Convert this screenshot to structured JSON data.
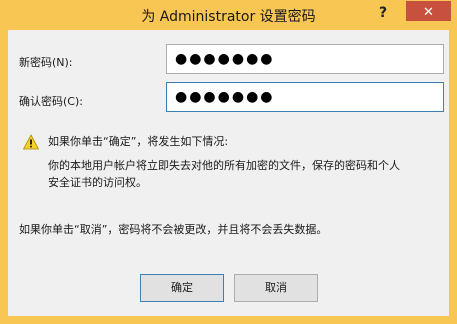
{
  "window": {
    "title": "为 Administrator 设置密码"
  },
  "titlebar": {
    "help_glyph": "?",
    "close_glyph": "✕"
  },
  "form": {
    "new_password_label": "新密码(N):",
    "new_password_value": "●●●●●●●",
    "confirm_password_label": "确认密码(C):",
    "confirm_password_value": "●●●●●●●"
  },
  "warning": {
    "icon": "warning-triangle-icon",
    "heading": "如果你单击“确定”，将发生如下情况:",
    "body_line1": "你的本地用户帐户将立即失去对他的所有加密的文件，保存的密码和个人",
    "body_line2": "安全证书的访问权。"
  },
  "cancel_note": "如果你单击“取消”，密码将不会被更改，并且将不会丢失数据。",
  "buttons": {
    "ok": "确定",
    "cancel": "取消"
  },
  "colors": {
    "frame": "#f8c653",
    "close": "#c7503f",
    "focus": "#3c7fb1"
  }
}
